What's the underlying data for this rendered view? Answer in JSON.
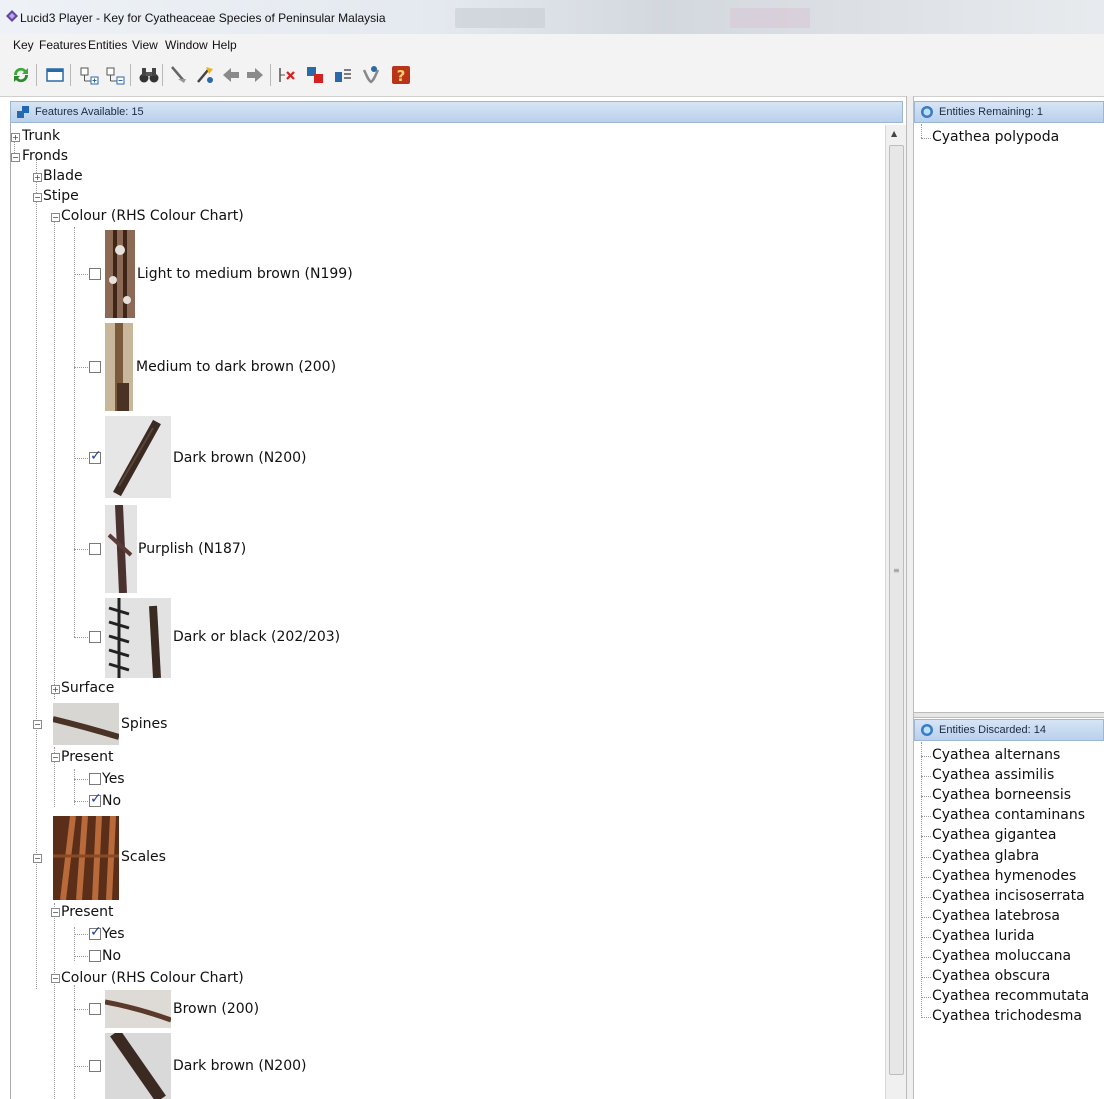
{
  "window": {
    "title": "Lucid3 Player - Key for Cyatheaceae Species of Peninsular Malaysia"
  },
  "menu": [
    "Key",
    "Features",
    "Entities",
    "View",
    "Window",
    "Help"
  ],
  "toolbar_icons": [
    "restart-icon",
    "window-icon",
    "expand-icon",
    "collapse-icon",
    "binoculars-icon",
    "prune-icon",
    "best-icon",
    "back-icon",
    "forward-icon",
    "exclude-icon",
    "differences-icon",
    "sort-icon",
    "filter-icon",
    "help-icon"
  ],
  "features_panel": {
    "header": "Features Available: 15",
    "trunk": "Trunk",
    "fronds": "Fronds",
    "blade": "Blade",
    "stipe": "Stipe",
    "stipe_colour": "Colour (RHS Colour Chart)",
    "stipe_colour_states": [
      {
        "label": "Light to medium brown (N199)",
        "checked": false
      },
      {
        "label": "Medium to dark brown (200)",
        "checked": false
      },
      {
        "label": "Dark brown (N200)",
        "checked": true
      },
      {
        "label": "Purplish (N187)",
        "checked": false
      },
      {
        "label": "Dark or black (202/203)",
        "checked": false
      }
    ],
    "surface": "Surface",
    "spines": "Spines",
    "spines_present": "Present",
    "spines_states": [
      {
        "label": "Yes",
        "checked": false
      },
      {
        "label": "No",
        "checked": true
      }
    ],
    "scales": "Scales",
    "scales_present": "Present",
    "scales_states": [
      {
        "label": "Yes",
        "checked": true
      },
      {
        "label": "No",
        "checked": false
      }
    ],
    "scales_colour": "Colour (RHS Colour Chart)",
    "scales_colour_states": [
      {
        "label": "Brown (200)",
        "checked": false
      },
      {
        "label": "Dark brown (N200)",
        "checked": false
      }
    ]
  },
  "remaining_panel": {
    "header": "Entities Remaining: 1",
    "items": [
      "Cyathea polypoda"
    ]
  },
  "discarded_panel": {
    "header": "Entities Discarded: 14",
    "items": [
      "Cyathea alternans",
      "Cyathea assimilis",
      "Cyathea borneensis",
      "Cyathea contaminans",
      "Cyathea gigantea",
      "Cyathea glabra",
      "Cyathea hymenodes",
      "Cyathea incisoserrata",
      "Cyathea latebrosa",
      "Cyathea lurida",
      "Cyathea moluccana",
      "Cyathea obscura",
      "Cyathea recommutata",
      "Cyathea trichodesma"
    ]
  }
}
